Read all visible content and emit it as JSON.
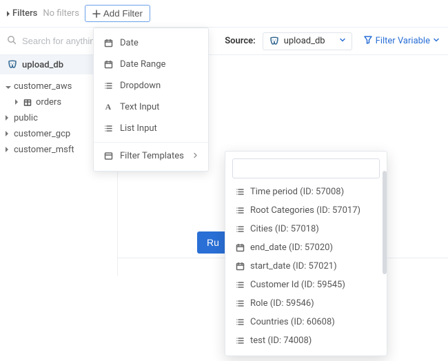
{
  "filterbar": {
    "label": "Filters",
    "status": "No filters",
    "add_label": "Add Filter"
  },
  "search": {
    "placeholder": "Search for anythin"
  },
  "source": {
    "label": "Source:",
    "selected": "upload_db"
  },
  "filter_variable_label": "Filter Variable",
  "sidebar": {
    "db_name": "upload_db",
    "items": [
      {
        "label": "customer_aws",
        "expanded": true,
        "children": [
          {
            "label": "orders",
            "type": "table"
          }
        ]
      },
      {
        "label": "public",
        "expanded": false
      },
      {
        "label": "customer_gcp",
        "expanded": false
      },
      {
        "label": "customer_msft",
        "expanded": false
      }
    ]
  },
  "run_button": "Ru",
  "add_filter_menu": {
    "items": [
      {
        "icon": "calendar",
        "label": "Date"
      },
      {
        "icon": "calendar",
        "label": "Date Range"
      },
      {
        "icon": "list",
        "label": "Dropdown"
      },
      {
        "icon": "text",
        "label": "Text Input"
      },
      {
        "icon": "list",
        "label": "List Input"
      }
    ],
    "templates_label": "Filter Templates"
  },
  "templates_menu": {
    "search_value": "",
    "items": [
      {
        "icon": "list",
        "label": "Time period (ID: 57008)"
      },
      {
        "icon": "list",
        "label": "Root Categories (ID: 57017)"
      },
      {
        "icon": "list",
        "label": "Cities (ID: 57018)"
      },
      {
        "icon": "calendar",
        "label": "end_date (ID: 57020)"
      },
      {
        "icon": "calendar",
        "label": "start_date (ID: 57021)"
      },
      {
        "icon": "list",
        "label": "Customer Id (ID: 59545)"
      },
      {
        "icon": "list",
        "label": "Role (ID: 59546)"
      },
      {
        "icon": "list",
        "label": "Countries (ID: 60608)"
      },
      {
        "icon": "list",
        "label": "test (ID: 74008)"
      }
    ]
  }
}
